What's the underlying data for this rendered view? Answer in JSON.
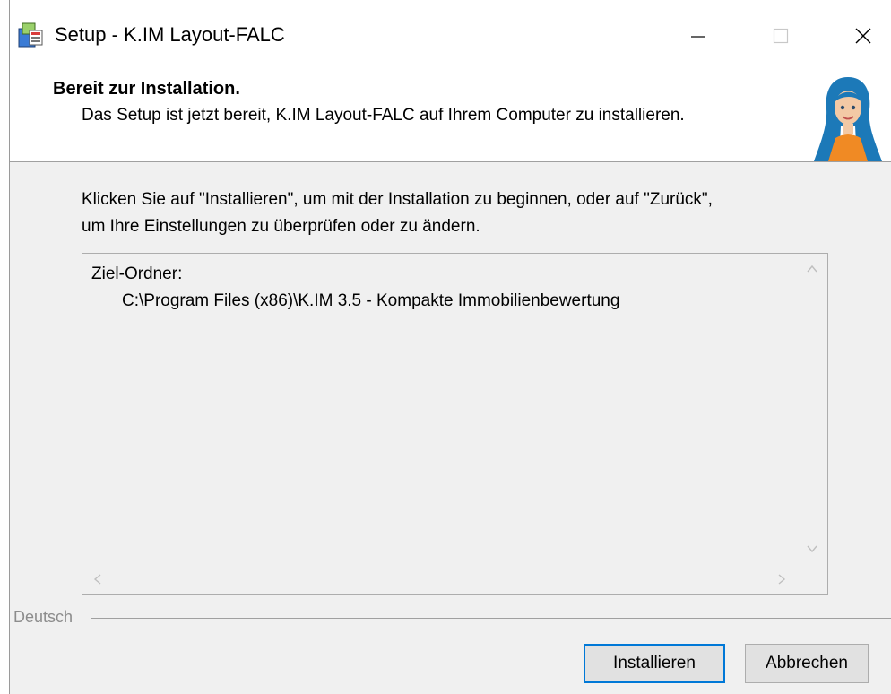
{
  "window": {
    "title": "Setup - K.IM Layout-FALC",
    "icon": "setup-app-icon",
    "controls": [
      "minimize-icon",
      "maximize-icon",
      "close-icon"
    ]
  },
  "header": {
    "heading": "Bereit zur Installation.",
    "subheading": "Das Setup ist jetzt bereit, K.IM Layout-FALC auf Ihrem Computer zu installieren.",
    "image": "wizard-mascot-image"
  },
  "intro": {
    "line1": "Klicken Sie auf \"Installieren\", um mit der Installation zu beginnen, oder auf \"Zurück\",",
    "line2": "um Ihre Einstellungen zu überprüfen oder zu ändern."
  },
  "summary": {
    "label": "Ziel-Ordner:",
    "path": "C:\\Program Files (x86)\\K.IM 3.5 - Kompakte Immobilienbewertung"
  },
  "language": {
    "label": "Deutsch"
  },
  "buttons": {
    "install": "Installieren",
    "cancel": "Abbrechen"
  },
  "colors": {
    "focus_border": "#0078d7",
    "dialog_background": "#f0f0f0"
  }
}
